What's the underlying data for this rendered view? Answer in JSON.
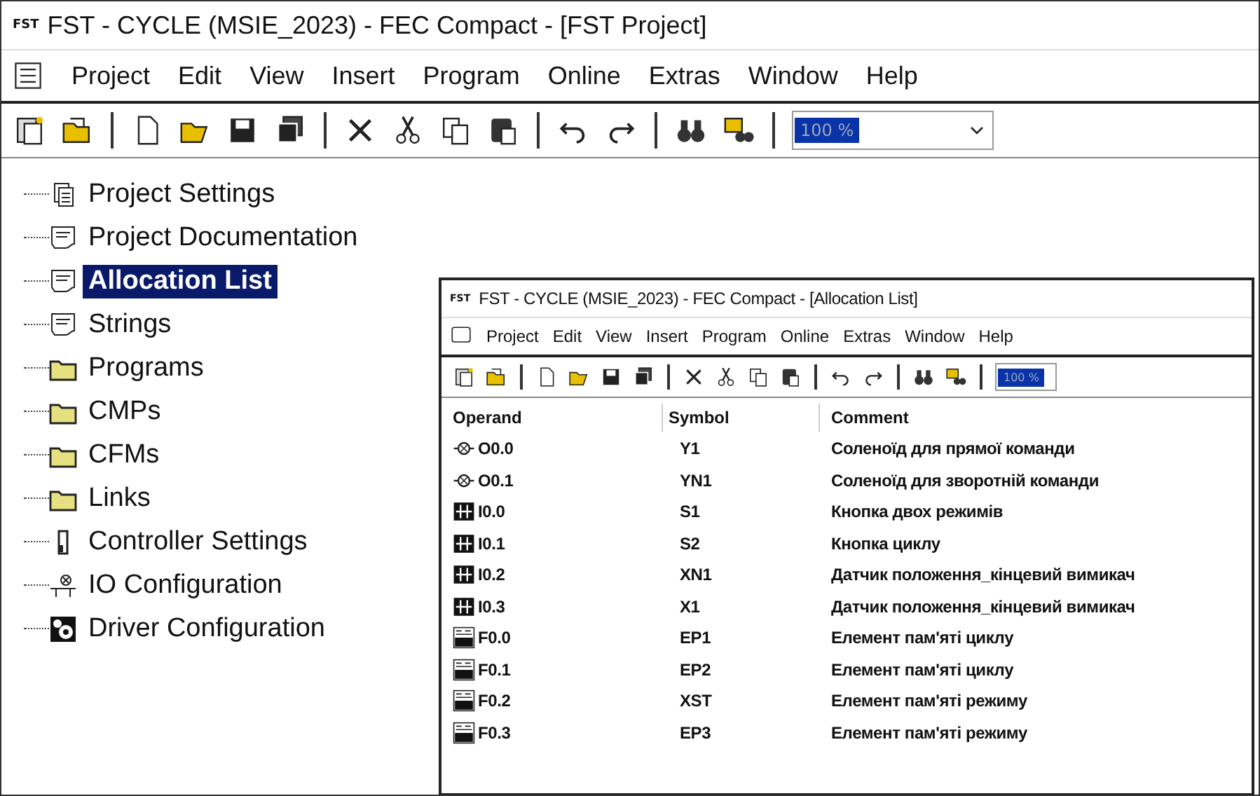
{
  "window": {
    "logo": "FST",
    "title": "FST - CYCLE (MSIE_2023) - FEC Compact - [FST Project]"
  },
  "menu": [
    "Project",
    "Edit",
    "View",
    "Insert",
    "Program",
    "Online",
    "Extras",
    "Window",
    "Help"
  ],
  "zoom": {
    "value": "100 %"
  },
  "tree": [
    {
      "label": "Project Settings",
      "kind": "settings",
      "selected": false
    },
    {
      "label": "Project Documentation",
      "kind": "doc",
      "selected": false
    },
    {
      "label": "Allocation List",
      "kind": "doc",
      "selected": true
    },
    {
      "label": "Strings",
      "kind": "doc",
      "selected": false
    },
    {
      "label": "Programs",
      "kind": "folder",
      "selected": false
    },
    {
      "label": "CMPs",
      "kind": "folder",
      "selected": false
    },
    {
      "label": "CFMs",
      "kind": "folder",
      "selected": false
    },
    {
      "label": "Links",
      "kind": "folder",
      "selected": false
    },
    {
      "label": "Controller Settings",
      "kind": "controller",
      "selected": false
    },
    {
      "label": "IO Configuration",
      "kind": "io",
      "selected": false
    },
    {
      "label": "Driver Configuration",
      "kind": "driver",
      "selected": false
    }
  ],
  "inner_window": {
    "logo": "FST",
    "title": "FST - CYCLE (MSIE_2023) - FEC Compact - [Allocation List]",
    "menu": [
      "Project",
      "Edit",
      "View",
      "Insert",
      "Program",
      "Online",
      "Extras",
      "Window",
      "Help"
    ],
    "zoom": {
      "value": "100 %"
    },
    "table": {
      "columns": [
        "Operand",
        "Symbol",
        "Comment"
      ],
      "rows": [
        {
          "kind": "output",
          "operand": "O0.0",
          "symbol": "Y1",
          "comment": "Соленоїд для прямої команди"
        },
        {
          "kind": "output",
          "operand": "O0.1",
          "symbol": "YN1",
          "comment": "Соленоїд для зворотній команди"
        },
        {
          "kind": "input",
          "operand": "I0.0",
          "symbol": "S1",
          "comment": "Кнопка двох режимів"
        },
        {
          "kind": "input",
          "operand": "I0.1",
          "symbol": "S2",
          "comment": "Кнопка циклу"
        },
        {
          "kind": "input",
          "operand": "I0.2",
          "symbol": "XN1",
          "comment": "Датчик положення_кінцевий вимикач"
        },
        {
          "kind": "input",
          "operand": "I0.3",
          "symbol": "X1",
          "comment": "Датчик положення_кінцевий вимикач"
        },
        {
          "kind": "flag",
          "operand": "F0.0",
          "symbol": "EP1",
          "comment": "Елемент пам'яті циклу"
        },
        {
          "kind": "flag",
          "operand": "F0.1",
          "symbol": "EP2",
          "comment": "Елемент пам'яті циклу"
        },
        {
          "kind": "flag",
          "operand": "F0.2",
          "symbol": "XST",
          "comment": "Елемент пам'яті режиму"
        },
        {
          "kind": "flag",
          "operand": "F0.3",
          "symbol": "EP3",
          "comment": "Елемент пам'яті режиму"
        }
      ]
    }
  }
}
